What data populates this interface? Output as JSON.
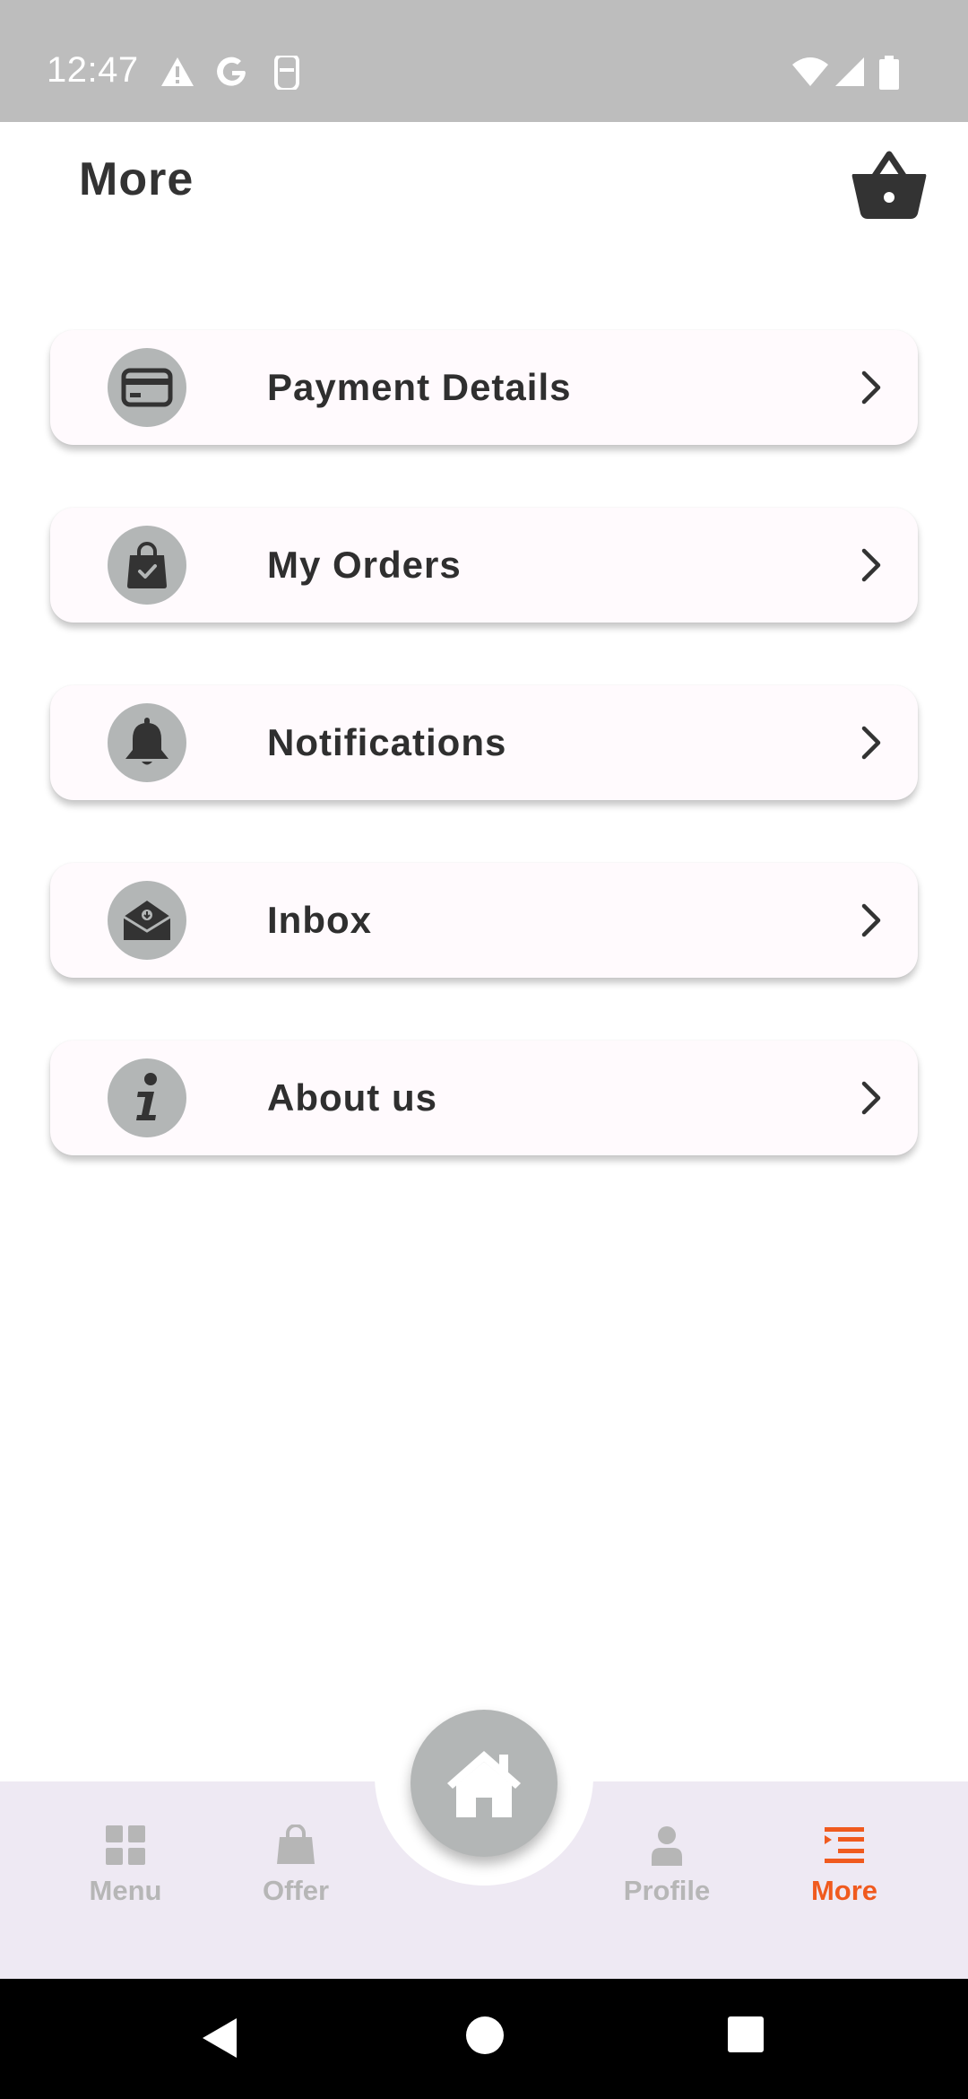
{
  "status_bar": {
    "time": "12:47",
    "left_icons": [
      "warning-icon",
      "google-icon",
      "sim-icon"
    ],
    "right_icons": [
      "wifi-icon",
      "signal-icon",
      "battery-icon"
    ]
  },
  "header": {
    "title": "More",
    "cart_icon": "basket-icon"
  },
  "menu": {
    "items": [
      {
        "label": "Payment Details",
        "icon": "credit-card-icon"
      },
      {
        "label": "My Orders",
        "icon": "shopping-bag-icon"
      },
      {
        "label": "Notifications",
        "icon": "bell-icon"
      },
      {
        "label": "Inbox",
        "icon": "mail-icon"
      },
      {
        "label": "About us",
        "icon": "info-icon"
      }
    ]
  },
  "bottom_nav": {
    "items": [
      {
        "label": "Menu",
        "icon": "grid-icon",
        "active": false
      },
      {
        "label": "Offer",
        "icon": "bag-icon",
        "active": false
      },
      {
        "label": "Home",
        "icon": "home-icon",
        "active": false
      },
      {
        "label": "Profile",
        "icon": "person-icon",
        "active": false
      },
      {
        "label": "More",
        "icon": "menu-lines-icon",
        "active": true
      }
    ]
  },
  "colors": {
    "accent": "#f05a1e",
    "inactive": "#b6b6b6",
    "icon_circle": "#b3b6b6",
    "nav_background": "#eee9f3",
    "card_background": "#fffafd"
  }
}
